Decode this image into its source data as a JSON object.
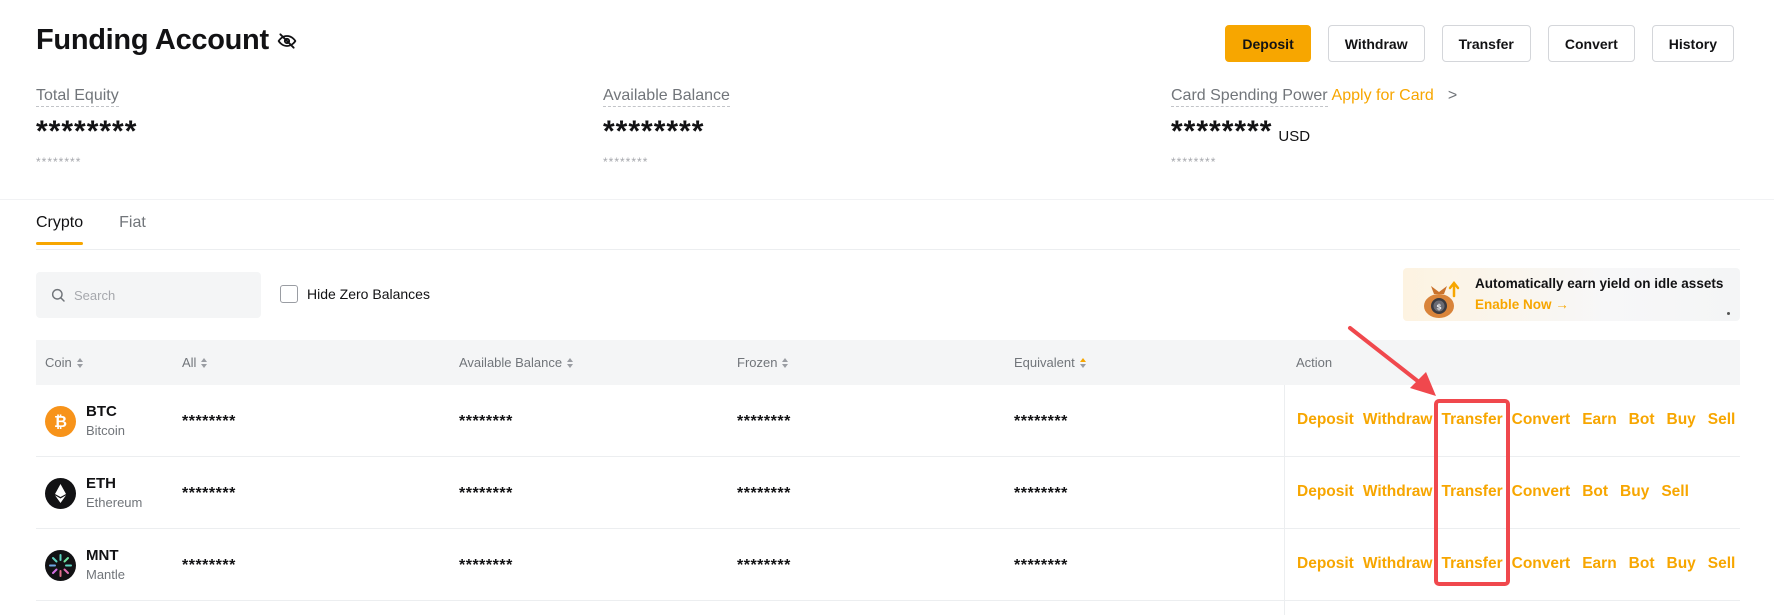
{
  "header": {
    "title": "Funding Account",
    "buttons": [
      "Deposit",
      "Withdraw",
      "Transfer",
      "Convert",
      "History"
    ]
  },
  "stats": {
    "total_equity": {
      "label": "Total Equity",
      "value": "********",
      "sub": "********"
    },
    "available_balance": {
      "label": "Available Balance",
      "value": "********",
      "sub": "********"
    },
    "card_spending": {
      "label": "Card Spending Power",
      "apply": "Apply for Card",
      "chevron": ">",
      "value": "********",
      "unit": "USD",
      "sub": "********"
    }
  },
  "tabs": [
    "Crypto",
    "Fiat"
  ],
  "active_tab": "Crypto",
  "filters": {
    "search_placeholder": "Search",
    "hide_zero_label": "Hide Zero Balances"
  },
  "promo": {
    "title": "Automatically earn yield on idle assets",
    "link": "Enable Now →"
  },
  "table": {
    "headers": [
      "Coin",
      "All",
      "Available Balance",
      "Frozen",
      "Equivalent",
      "Action"
    ],
    "rows": [
      {
        "symbol": "BTC",
        "name": "Bitcoin",
        "all": "********",
        "available": "********",
        "frozen": "********",
        "equivalent": "********",
        "actions": [
          "Deposit",
          "Withdraw",
          "Transfer",
          "Convert",
          "Earn",
          "Bot",
          "Buy",
          "Sell"
        ]
      },
      {
        "symbol": "ETH",
        "name": "Ethereum",
        "all": "********",
        "available": "********",
        "frozen": "********",
        "equivalent": "********",
        "actions": [
          "Deposit",
          "Withdraw",
          "Transfer",
          "Convert",
          "Bot",
          "Buy",
          "Sell"
        ]
      },
      {
        "symbol": "MNT",
        "name": "Mantle",
        "all": "********",
        "available": "********",
        "frozen": "********",
        "equivalent": "********",
        "actions": [
          "Deposit",
          "Withdraw",
          "Transfer",
          "Convert",
          "Earn",
          "Bot",
          "Buy",
          "Sell"
        ]
      }
    ]
  },
  "colors": {
    "accent": "#f7a600",
    "annotation": "#f0484d",
    "btc": "#f7931a",
    "eth": "#121214"
  }
}
